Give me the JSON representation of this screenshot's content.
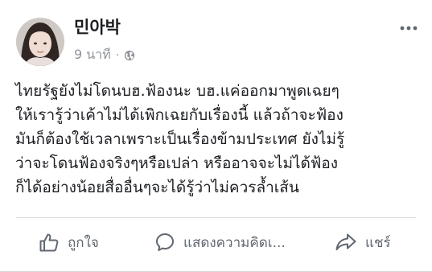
{
  "post": {
    "author": "민아박",
    "timestamp": "9 นาที",
    "separator": "·",
    "privacy_icon": "globe-icon",
    "more_icon": "more-options-icon",
    "avatar_icon": "profile-photo",
    "body_lines": [
      "ไทยรัฐยังไม่โดนบฮ.ฟ้องนะ บฮ.แค่ออกมาพูดเฉยๆ",
      "ให้เรารู้ว่าเค้าไม่ได้เพิกเฉยกับเรื่องนี้ แล้วถ้าจะฟ้อง",
      "มันก็ต้องใช้เวลาเพราะเป็นเรื่องข้ามประเทศ ยังไม่รู้",
      "ว่าจะโดนฟ้องจริงๆหรือเปล่า หรืออาจจะไม่ได้ฟ้อง",
      "ก็ได้อย่างน้อยสื่ออื่นๆจะได้รู้ว่าไม่ควรล้ำเส้น"
    ]
  },
  "actions": {
    "like": {
      "label": "ถูกใจ",
      "icon": "thumbs-up-icon"
    },
    "comment": {
      "label": "แสดงความคิดเ...",
      "icon": "comment-icon"
    },
    "share": {
      "label": "แชร์",
      "icon": "share-arrow-icon"
    }
  },
  "colors": {
    "text": "#1c1e21",
    "secondary": "#90949c",
    "action": "#606770",
    "divider": "#dadde1",
    "background": "#ffffff"
  }
}
